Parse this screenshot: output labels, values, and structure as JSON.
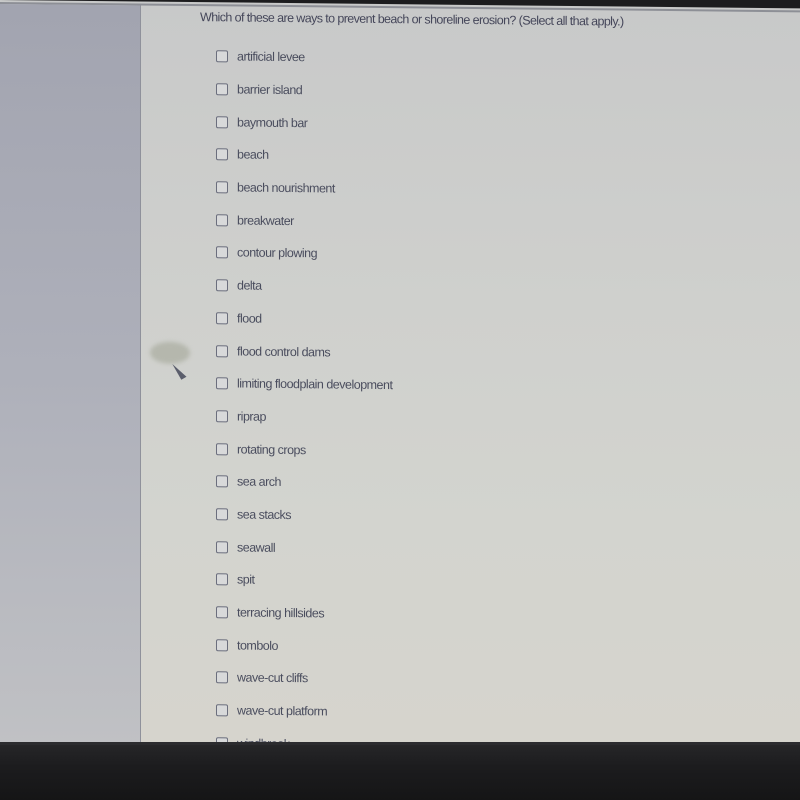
{
  "question": {
    "text": "Which of these are ways to prevent beach or shoreline erosion?  (Select all that apply.)"
  },
  "options": [
    {
      "label": "artificial levee",
      "checked": false
    },
    {
      "label": "barrier island",
      "checked": false
    },
    {
      "label": "baymouth bar",
      "checked": false
    },
    {
      "label": "beach",
      "checked": false
    },
    {
      "label": "beach nourishment",
      "checked": false
    },
    {
      "label": "breakwater",
      "checked": false
    },
    {
      "label": "contour plowing",
      "checked": false
    },
    {
      "label": "delta",
      "checked": false
    },
    {
      "label": "flood",
      "checked": false
    },
    {
      "label": "flood control dams",
      "checked": false
    },
    {
      "label": "limiting floodplain development",
      "checked": false
    },
    {
      "label": "riprap",
      "checked": false
    },
    {
      "label": "rotating crops",
      "checked": false
    },
    {
      "label": "sea arch",
      "checked": false
    },
    {
      "label": "sea stacks",
      "checked": false
    },
    {
      "label": "seawall",
      "checked": false
    },
    {
      "label": "spit",
      "checked": false
    },
    {
      "label": "terracing hillsides",
      "checked": false
    },
    {
      "label": "tombolo",
      "checked": false
    },
    {
      "label": "wave-cut cliffs",
      "checked": false
    },
    {
      "label": "wave-cut platform",
      "checked": false
    },
    {
      "label": "windbreak",
      "checked": false
    }
  ],
  "colors": {
    "text": "#45475a",
    "checkbox_border": "#6b6e7d",
    "sidebar": "#a2a4b0",
    "background": "#cfd0cd",
    "bezel": "#1c1c1e"
  }
}
